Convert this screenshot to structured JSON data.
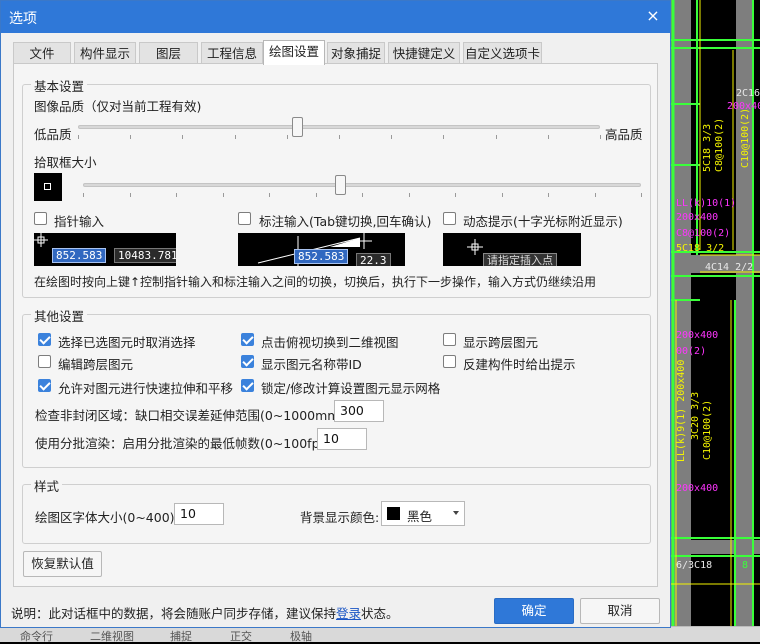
{
  "dialog": {
    "title": "选项",
    "close_symbol": "×"
  },
  "tabs": [
    {
      "label": "文件",
      "active": false
    },
    {
      "label": "构件显示",
      "active": false
    },
    {
      "label": "图层",
      "active": false
    },
    {
      "label": "工程信息",
      "active": false
    },
    {
      "label": "绘图设置",
      "active": true
    },
    {
      "label": "对象捕捉",
      "active": false
    },
    {
      "label": "快捷键定义",
      "active": false
    },
    {
      "label": "自定义选项卡",
      "active": false
    }
  ],
  "basic": {
    "legend": "基本设置",
    "image_quality_label": "图像品质（仅对当前工程有效)",
    "low_label": "低品质",
    "high_label": "高品质",
    "quality_level": 0.42,
    "pickbox_label": "拾取框大小",
    "pickbox_level": 0.46,
    "pointer_input_label": "指针输入",
    "dimension_input_label": "标注输入(Tab键切换,回车确认)",
    "dynamic_prompt_label": "动态提示(十字光标附近显示)",
    "pointer_input_checked": false,
    "dimension_input_checked": false,
    "dynamic_prompt_checked": false,
    "preview1_x": "852.583",
    "preview1_y": "10483.781",
    "preview2_value": "852.583",
    "preview2_tail": "22.3",
    "preview3_prompt": "请指定插入点",
    "hint": "在绘图时按向上键↑控制指针输入和标注输入之间的切换，切换后，执行下一步操作，输入方式仍继续沿用"
  },
  "other": {
    "legend": "其他设置",
    "checkboxes": [
      {
        "label": "选择已选图元时取消选择",
        "checked": true
      },
      {
        "label": "点击俯视切换到二维视图",
        "checked": true
      },
      {
        "label": "显示跨层图元",
        "checked": false
      },
      {
        "label": "编辑跨层图元",
        "checked": false
      },
      {
        "label": "显示图元名称带ID",
        "checked": true
      },
      {
        "label": "反建构件时给出提示",
        "checked": false
      },
      {
        "label": "允许对图元进行快速拉伸和平移",
        "checked": true
      },
      {
        "label": "锁定/修改计算设置图元显示网格",
        "checked": true
      }
    ],
    "gap_label": "检查非封闭区域：缺口相交误差延伸范围(0~1000mm):",
    "gap_value": "300",
    "batch_label": "使用分批渲染：启用分批渲染的最低帧数(0~100fps):",
    "batch_value": "10"
  },
  "style": {
    "legend": "样式",
    "font_size_label": "绘图区字体大小(0~400):",
    "font_size_value": "10",
    "bg_color_label": "背景显示颜色:",
    "bg_color_value": "黑色",
    "bg_swatch": "#000000"
  },
  "restore_label": "恢复默认值",
  "footer": {
    "note_prefix": "说明：此对话框中的数据，将会随账户同步存储，建议保持",
    "note_link": "登录",
    "note_suffix": "状态。",
    "ok_label": "确定",
    "cancel_label": "取消"
  },
  "cad": {
    "labels": [
      "2C16",
      "200x400",
      "5C18 3/3",
      "C8@100(2)",
      "C10@100(2)",
      "LL(k)10(1)",
      "200x400",
      "C8@100(2)",
      "5C18 3/2",
      "4C14 2/2",
      "200x400",
      "00(2)",
      "LL(k)9(1) 200x400",
      "3C20 3/3",
      "C10@100(2)",
      "200x400",
      "6/3C18",
      "8"
    ]
  },
  "strip": [
    "命令行",
    "二维视图",
    "捕捉",
    "正交",
    "极轴"
  ],
  "colors": {
    "accent": "#2f78d8",
    "cad_magenta": "#ff35ff",
    "cad_yellow": "#f4f400",
    "cad_green": "#3aff3a"
  }
}
